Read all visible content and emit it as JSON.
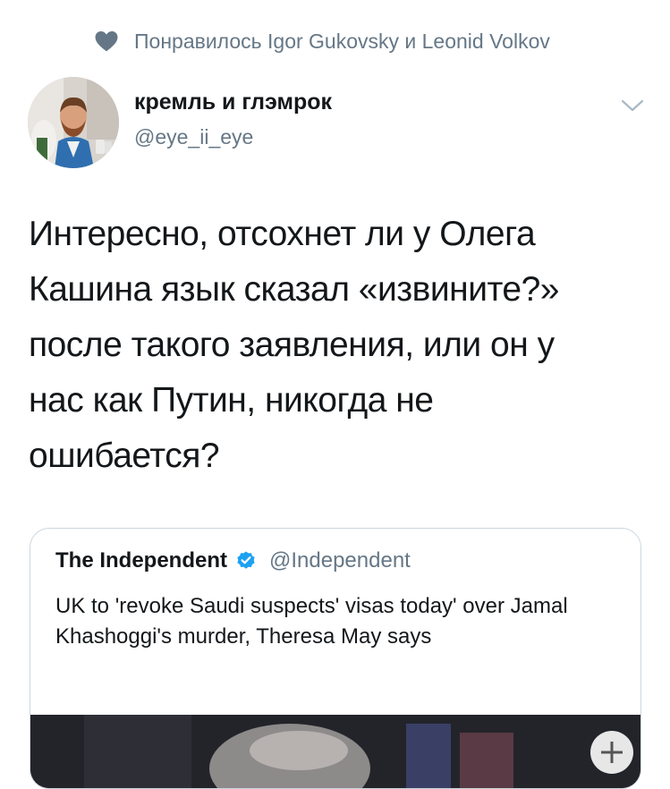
{
  "liked_by": {
    "text": "Понравилось Igor Gukovsky и Leonid Volkov",
    "icon": "heart-icon"
  },
  "tweet": {
    "author_name": "кремль и глэмрок",
    "author_handle": "@eye_ii_eye",
    "text": "Интересно, отсохнет ли у Олега\nКашина язык сказал «извините?»\nпосле такого заявления, или он у\nнас как Путин, никогда не\nошибается?",
    "menu_icon": "chevron-down-icon"
  },
  "quoted_tweet": {
    "author_name": "The Independent",
    "verified": true,
    "author_handle": "@Independent",
    "text": "UK to 'revoke Saudi suspects' visas today' over Jamal Khashoggi's murder, Theresa May says"
  },
  "colors": {
    "primary_text": "#14171a",
    "secondary_text": "#657786",
    "verified_blue": "#1da1f2",
    "border": "#ccd6dd"
  }
}
